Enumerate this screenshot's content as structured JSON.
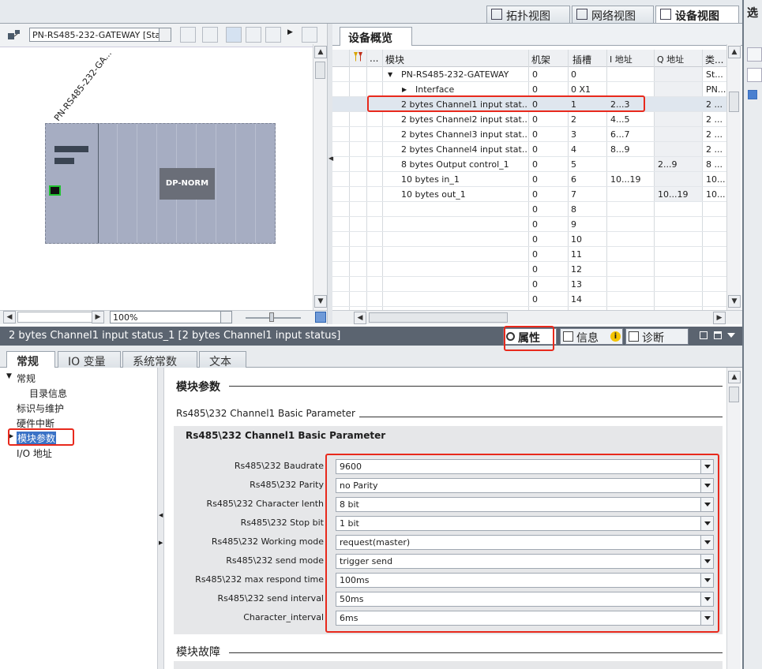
{
  "view_tabs": [
    {
      "label": "拓扑视图",
      "active": false
    },
    {
      "label": "网络视图",
      "active": false
    },
    {
      "label": "设备视图",
      "active": true
    }
  ],
  "right_edge_label": "选",
  "device_selector": {
    "value": "PN-RS485-232-GATEWAY [Stan"
  },
  "device_overview_tab": "设备概览",
  "canvas": {
    "device_name": "PN-RS485-232-GA...",
    "module_label": "DP-NORM"
  },
  "zoom": {
    "value": "100%"
  },
  "table": {
    "headers": {
      "dots": "...",
      "module": "模块",
      "rack": "机架",
      "slot": "插槽",
      "i_addr": "I 地址",
      "q_addr": "Q 地址",
      "type": "类..."
    },
    "rows": [
      {
        "indent": 1,
        "expand": "▼",
        "module": "PN-RS485-232-GATEWAY",
        "rack": "0",
        "slot": "0",
        "i_addr": "",
        "q_addr": "",
        "type": "St..."
      },
      {
        "indent": 2,
        "expand": "▶",
        "module": "Interface",
        "rack": "0",
        "slot": "0 X1",
        "i_addr": "",
        "q_addr": "",
        "type": "PN..."
      },
      {
        "indent": 1,
        "expand": "",
        "module": "2 bytes Channel1 input stat...",
        "rack": "0",
        "slot": "1",
        "i_addr": "2...3",
        "q_addr": "",
        "type": "2 ..."
      },
      {
        "indent": 1,
        "expand": "",
        "module": "2 bytes Channel2 input stat...",
        "rack": "0",
        "slot": "2",
        "i_addr": "4...5",
        "q_addr": "",
        "type": "2 ..."
      },
      {
        "indent": 1,
        "expand": "",
        "module": "2 bytes Channel3 input stat...",
        "rack": "0",
        "slot": "3",
        "i_addr": "6...7",
        "q_addr": "",
        "type": "2 ..."
      },
      {
        "indent": 1,
        "expand": "",
        "module": "2 bytes Channel4 input stat...",
        "rack": "0",
        "slot": "4",
        "i_addr": "8...9",
        "q_addr": "",
        "type": "2 ..."
      },
      {
        "indent": 1,
        "expand": "",
        "module": "8 bytes Output control_1",
        "rack": "0",
        "slot": "5",
        "i_addr": "",
        "q_addr": "2...9",
        "type": "8 ..."
      },
      {
        "indent": 1,
        "expand": "",
        "module": "10 bytes in_1",
        "rack": "0",
        "slot": "6",
        "i_addr": "10...19",
        "q_addr": "",
        "type": "10..."
      },
      {
        "indent": 1,
        "expand": "",
        "module": "10 bytes out_1",
        "rack": "0",
        "slot": "7",
        "i_addr": "",
        "q_addr": "10...19",
        "type": "10..."
      },
      {
        "indent": 1,
        "expand": "",
        "module": "",
        "rack": "0",
        "slot": "8",
        "i_addr": "",
        "q_addr": "",
        "type": ""
      },
      {
        "indent": 1,
        "expand": "",
        "module": "",
        "rack": "0",
        "slot": "9",
        "i_addr": "",
        "q_addr": "",
        "type": ""
      },
      {
        "indent": 1,
        "expand": "",
        "module": "",
        "rack": "0",
        "slot": "10",
        "i_addr": "",
        "q_addr": "",
        "type": ""
      },
      {
        "indent": 1,
        "expand": "",
        "module": "",
        "rack": "0",
        "slot": "11",
        "i_addr": "",
        "q_addr": "",
        "type": ""
      },
      {
        "indent": 1,
        "expand": "",
        "module": "",
        "rack": "0",
        "slot": "12",
        "i_addr": "",
        "q_addr": "",
        "type": ""
      },
      {
        "indent": 1,
        "expand": "",
        "module": "",
        "rack": "0",
        "slot": "13",
        "i_addr": "",
        "q_addr": "",
        "type": ""
      },
      {
        "indent": 1,
        "expand": "",
        "module": "",
        "rack": "0",
        "slot": "14",
        "i_addr": "",
        "q_addr": "",
        "type": ""
      }
    ]
  },
  "props_bar": {
    "title": "2 bytes Channel1 input status_1 [2 bytes Channel1 input status]",
    "properties": "属性",
    "info": "信息",
    "diagnostics": "诊断"
  },
  "prop_tabs": [
    {
      "label": "常规",
      "active": true
    },
    {
      "label": "IO 变量",
      "active": false
    },
    {
      "label": "系统常数",
      "active": false
    },
    {
      "label": "文本",
      "active": false
    }
  ],
  "nav": {
    "general": "常规",
    "catalog": "目录信息",
    "identification": "标识与维护",
    "hw_interrupt": "硬件中断",
    "module_params": "模块参数",
    "io_address": "I/O 地址"
  },
  "params": {
    "section_title": "模块参数",
    "subsection_title": "Rs485\\232 Channel1 Basic Parameter",
    "group_title": "Rs485\\232 Channel1 Basic Parameter",
    "fields": [
      {
        "label": "Rs485\\232  Baudrate",
        "value": "9600"
      },
      {
        "label": "Rs485\\232  Parity",
        "value": "no Parity"
      },
      {
        "label": "Rs485\\232  Character lenth",
        "value": "8 bit"
      },
      {
        "label": "Rs485\\232 Stop bit",
        "value": "1 bit"
      },
      {
        "label": "Rs485\\232 Working mode",
        "value": "request(master)"
      },
      {
        "label": "Rs485\\232 send mode",
        "value": "trigger send"
      },
      {
        "label": "Rs485\\232 max respond time",
        "value": "100ms"
      },
      {
        "label": "Rs485\\232 send interval",
        "value": "50ms"
      },
      {
        "label": "Character_interval",
        "value": "6ms"
      }
    ],
    "fault_title": "模块故障"
  },
  "colors": {
    "highlight": "#e8291c",
    "titlebar": "#5b6470",
    "module_body": "#a6adc2"
  }
}
